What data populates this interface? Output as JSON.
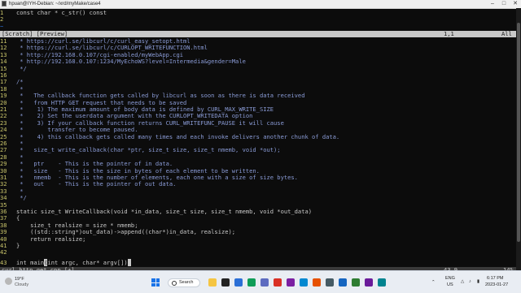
{
  "window": {
    "title": "hpuan@IYH-Debian: ~/xrd/myMake/case4"
  },
  "scratch": {
    "lines": [
      {
        "num": "1",
        "text": "const char * c_str() const"
      },
      {
        "num": "2",
        "text": ""
      }
    ],
    "status_left": "[Scratch] [Preview]",
    "status_pos": "1,1",
    "status_right": "All"
  },
  "code": {
    "lines": [
      {
        "num": "11",
        "text": " * https://curl.se/libcurl/c/curl_easy_setopt.html",
        "kind": "comment"
      },
      {
        "num": "12",
        "text": " * https://curl.se/libcurl/c/CURLOPT_WRITEFUNCTION.html",
        "kind": "comment"
      },
      {
        "num": "13",
        "text": " * http://192.168.0.107/cgi-enabled/myWebApp.cgi",
        "kind": "comment"
      },
      {
        "num": "14",
        "text": " * http://192.168.0.107:1234/MyEchoWS?level=Intermedia&gender=Male",
        "kind": "comment"
      },
      {
        "num": "15",
        "text": " */",
        "kind": "comment"
      },
      {
        "num": "16",
        "text": "",
        "kind": "code"
      },
      {
        "num": "17",
        "text": "/*",
        "kind": "comment"
      },
      {
        "num": "18",
        "text": " *",
        "kind": "comment"
      },
      {
        "num": "19",
        "text": " *   The callback function gets called by libcurl as soon as there is data received",
        "kind": "comment"
      },
      {
        "num": "20",
        "text": " *   from HTTP GET request that needs to be saved",
        "kind": "comment"
      },
      {
        "num": "21",
        "text": " *    1) The maximum amount of body data is defined by CURL_MAX_WRITE_SIZE",
        "kind": "comment"
      },
      {
        "num": "22",
        "text": " *    2) Set the userdata argument with the CURLOPT_WRITEDATA option",
        "kind": "comment"
      },
      {
        "num": "23",
        "text": " *    3) If your callback function returns CURL_WRITEFUNC_PAUSE it will cause",
        "kind": "comment"
      },
      {
        "num": "24",
        "text": " *       transfer to become paused.",
        "kind": "comment"
      },
      {
        "num": "25",
        "text": " *    4) this callback gets called many times and each invoke delivers another chunk of data.",
        "kind": "comment"
      },
      {
        "num": "26",
        "text": " *",
        "kind": "comment"
      },
      {
        "num": "27",
        "text": " *   size_t write_callback(char *ptr, size_t size, size_t nmemb, void *out);",
        "kind": "comment"
      },
      {
        "num": "28",
        "text": " *",
        "kind": "comment"
      },
      {
        "num": "29",
        "text": " *   ptr    - This is the pointer of in data.",
        "kind": "comment"
      },
      {
        "num": "30",
        "text": " *   size   - This is the size in bytes of each element to be written.",
        "kind": "comment"
      },
      {
        "num": "31",
        "text": " *   nmemb  - This is the number of elements, each one with a size of size bytes.",
        "kind": "comment"
      },
      {
        "num": "32",
        "text": " *   out    - This is the pointer of out data.",
        "kind": "comment"
      },
      {
        "num": "33",
        "text": " *",
        "kind": "comment"
      },
      {
        "num": "34",
        "text": " */",
        "kind": "comment"
      },
      {
        "num": "35",
        "text": "",
        "kind": "code"
      },
      {
        "num": "36",
        "text": "static size_t WriteCallback(void *in_data, size_t size, size_t nmemb, void *out_data)",
        "kind": "code"
      },
      {
        "num": "37",
        "text": "{",
        "kind": "code"
      },
      {
        "num": "38",
        "text": "    size_t realsize = size * nmemb;",
        "kind": "code"
      },
      {
        "num": "39",
        "text": "    ((std::string*)out_data)->append((char*)in_data, realsize);",
        "kind": "code"
      },
      {
        "num": "40",
        "text": "    return realsize;",
        "kind": "code"
      },
      {
        "num": "41",
        "text": "}",
        "kind": "code"
      },
      {
        "num": "42",
        "text": "",
        "kind": "code"
      },
      {
        "num": "43",
        "text": "int main(int argc, char* argv[])",
        "kind": "code"
      }
    ]
  },
  "file_status": {
    "name": "curl_http_get.cpp [+]",
    "pos": "43,9",
    "pct": "14%"
  },
  "taskbar": {
    "weather_temp": "19°F",
    "weather_desc": "Cloudy",
    "search_label": "Search",
    "lang_1": "ENG",
    "lang_2": "US",
    "time": "6:17 PM",
    "date": "2023-01-27"
  }
}
